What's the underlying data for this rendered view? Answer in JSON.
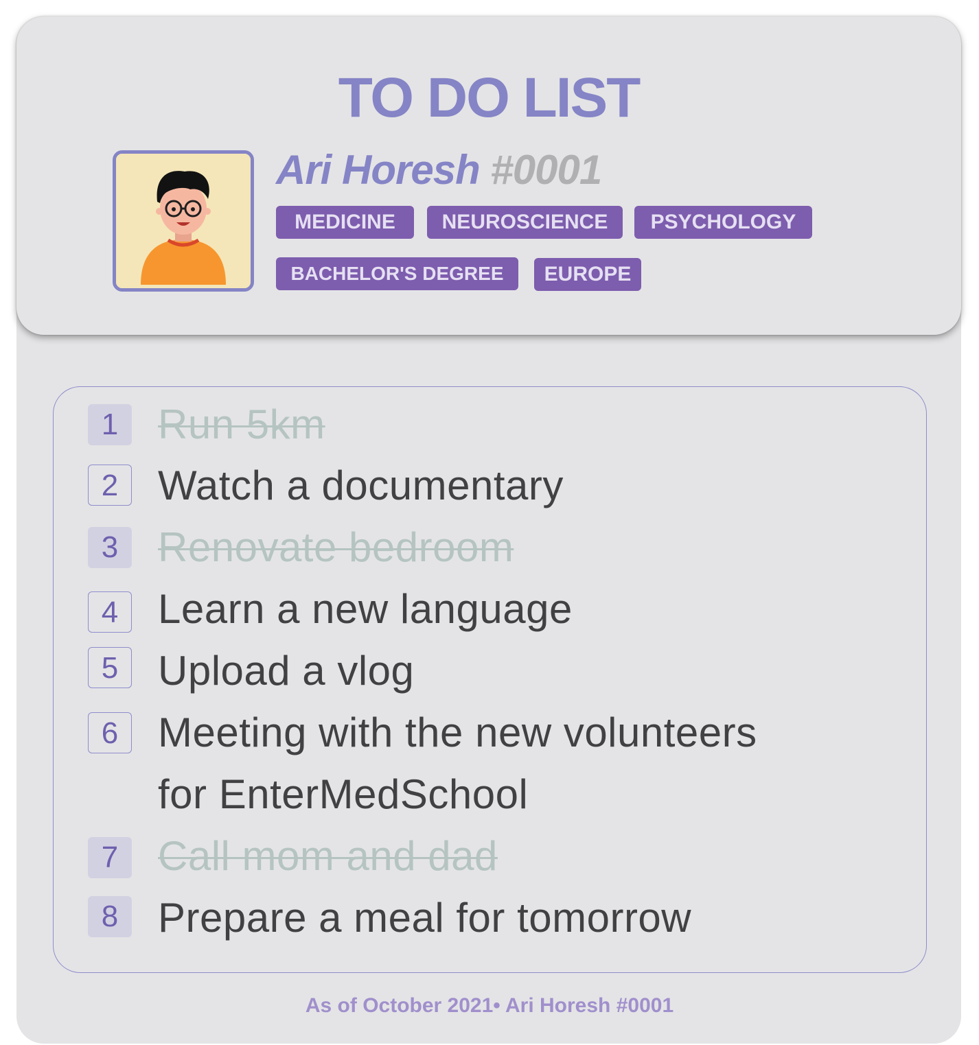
{
  "title": "TO DO LIST",
  "profile": {
    "name": "Ari Horesh",
    "id": "#0001",
    "tags": [
      "MEDICINE",
      "NEUROSCIENCE",
      "PSYCHOLOGY",
      "BACHELOR'S DEGREE",
      "EUROPE"
    ]
  },
  "todos": [
    {
      "num": "1",
      "text": "Run 5km",
      "done": true
    },
    {
      "num": "2",
      "text": "Watch a documentary",
      "done": false
    },
    {
      "num": "3",
      "text": "Renovate bedroom",
      "done": true
    },
    {
      "num": "4",
      "text": "Learn a new language",
      "done": false
    },
    {
      "num": "5",
      "text": "Upload a vlog",
      "done": false
    },
    {
      "num": "6",
      "text": "Meeting with the new volunteers",
      "text_line2": "for EnterMedSchool",
      "done": false
    },
    {
      "num": "7",
      "text": "Call mom and dad",
      "done": true
    },
    {
      "num": "8",
      "text": "Prepare a meal for tomorrow",
      "done": false
    }
  ],
  "footer": "As of October 2021• Ari Horesh #0001",
  "colors": {
    "accent": "#8584c6",
    "tag_bg": "#7d5dae",
    "done_text": "#b5c4c1",
    "card_bg": "#e4e4e6"
  }
}
